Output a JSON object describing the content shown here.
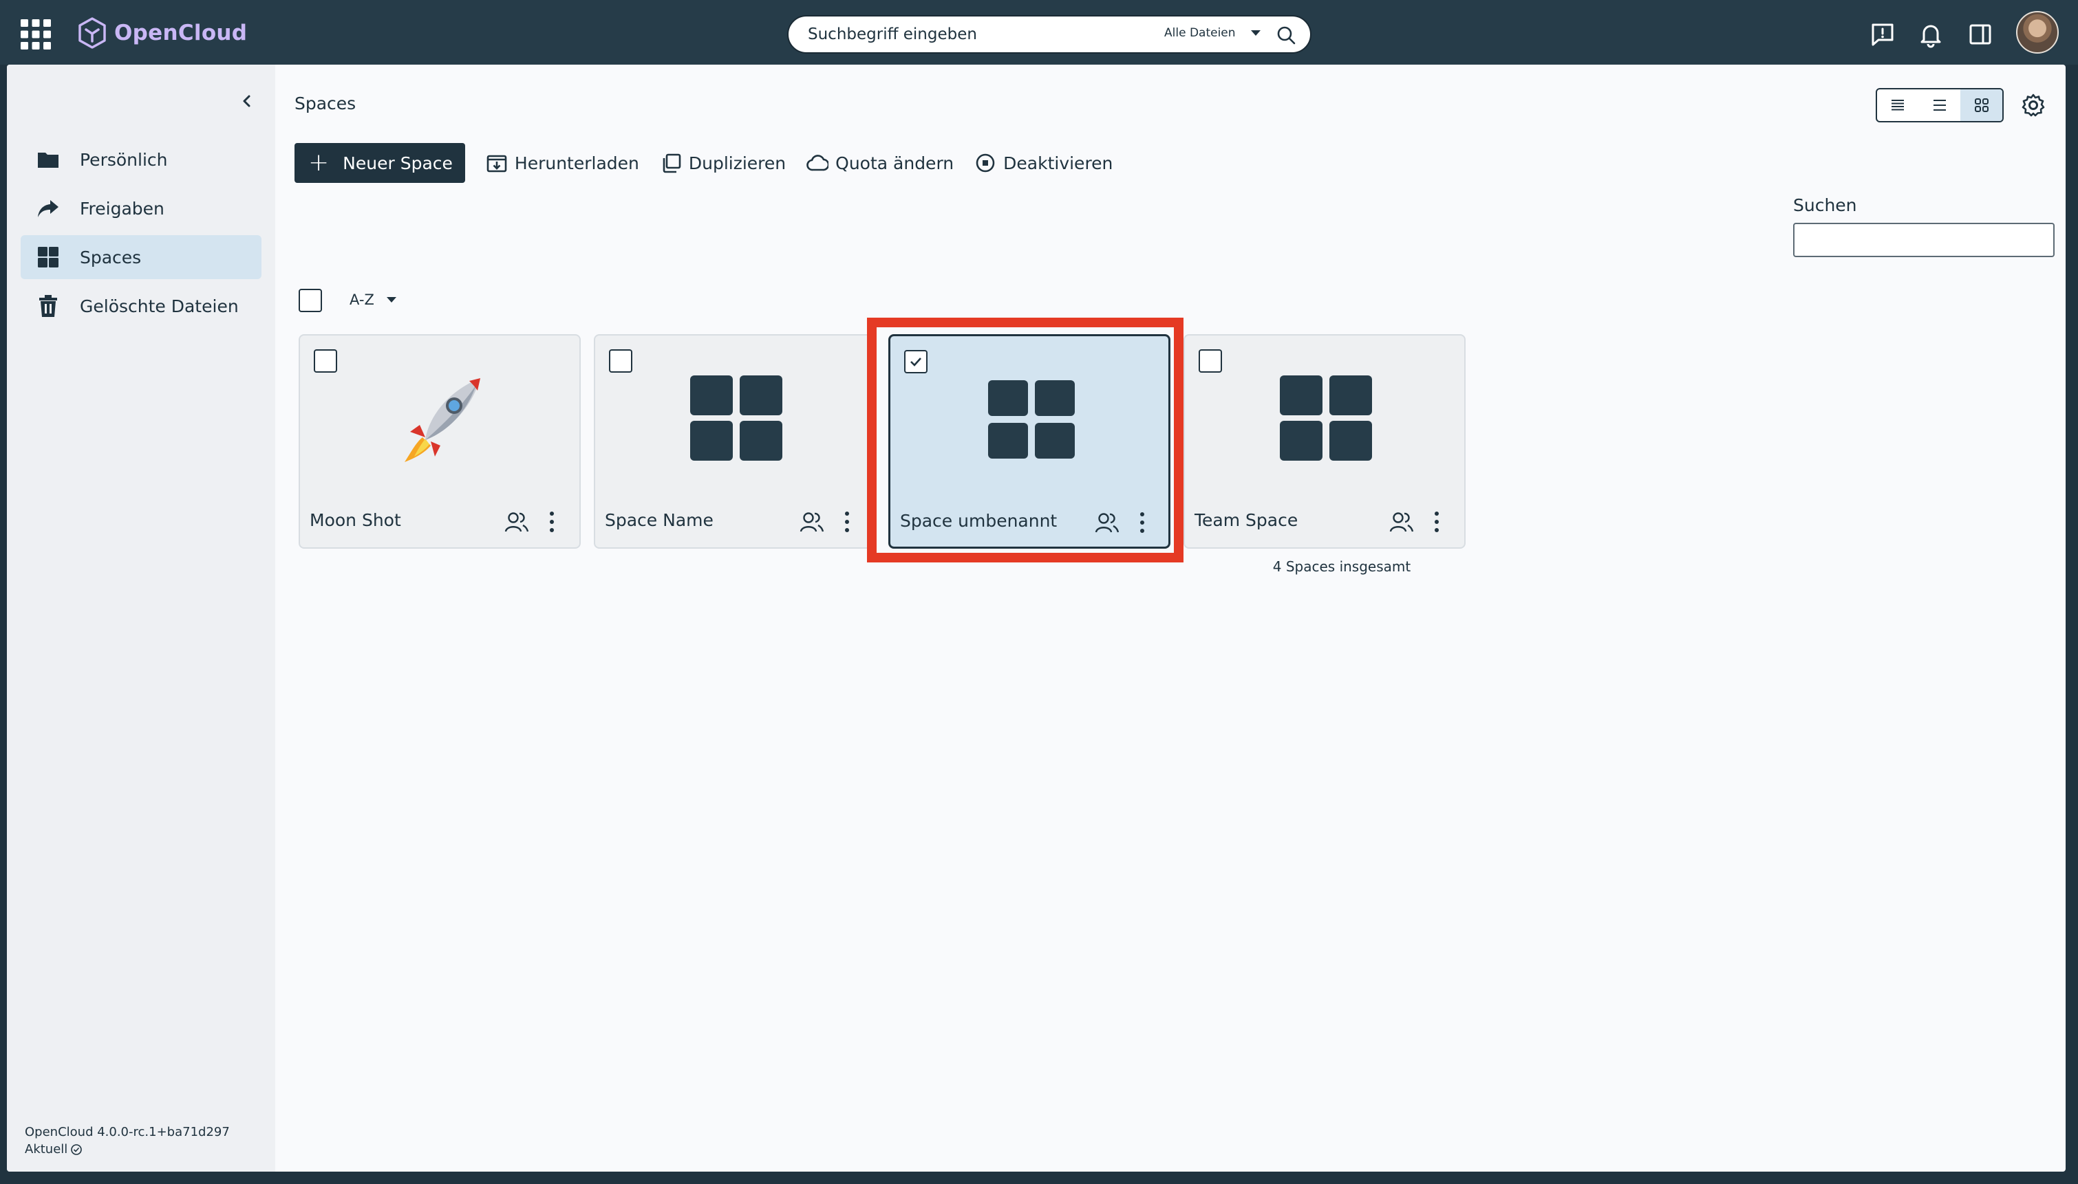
{
  "app": {
    "name": "OpenCloud"
  },
  "search": {
    "placeholder": "Suchbegriff eingeben",
    "scope": "Alle Dateien"
  },
  "sidebar": {
    "items": [
      {
        "label": "Persönlich",
        "icon": "folder-icon",
        "active": false
      },
      {
        "label": "Freigaben",
        "icon": "share-icon",
        "active": false
      },
      {
        "label": "Spaces",
        "icon": "spaces-grid-icon",
        "active": true
      },
      {
        "label": "Gelöschte Dateien",
        "icon": "trash-icon",
        "active": false
      }
    ],
    "version": "OpenCloud 4.0.0-rc.1+ba71d297",
    "status": "Aktuell"
  },
  "main": {
    "title": "Spaces",
    "toolbar": {
      "new_space": "Neuer Space",
      "download": "Herunterladen",
      "duplicate": "Duplizieren",
      "quota": "Quota ändern",
      "disable": "Deaktivieren"
    },
    "filter": {
      "label": "Suchen",
      "value": ""
    },
    "sort": "A-Z",
    "spaces": [
      {
        "name": "Moon Shot",
        "image": "rocket-icon",
        "selected": false
      },
      {
        "name": "Space Name",
        "image": "space-grid-icon",
        "selected": false
      },
      {
        "name": "Space umbenannt",
        "image": "space-grid-icon",
        "selected": true
      },
      {
        "name": "Team Space",
        "image": "space-grid-icon",
        "selected": false
      }
    ],
    "total": "4 Spaces insgesamt",
    "view_mode": "tiles"
  },
  "colors": {
    "topbar": "#263c49",
    "accent": "#20333f",
    "selection": "#d3e4f0",
    "highlight": "#e53a24",
    "logo_text": "#c9b7f5"
  }
}
